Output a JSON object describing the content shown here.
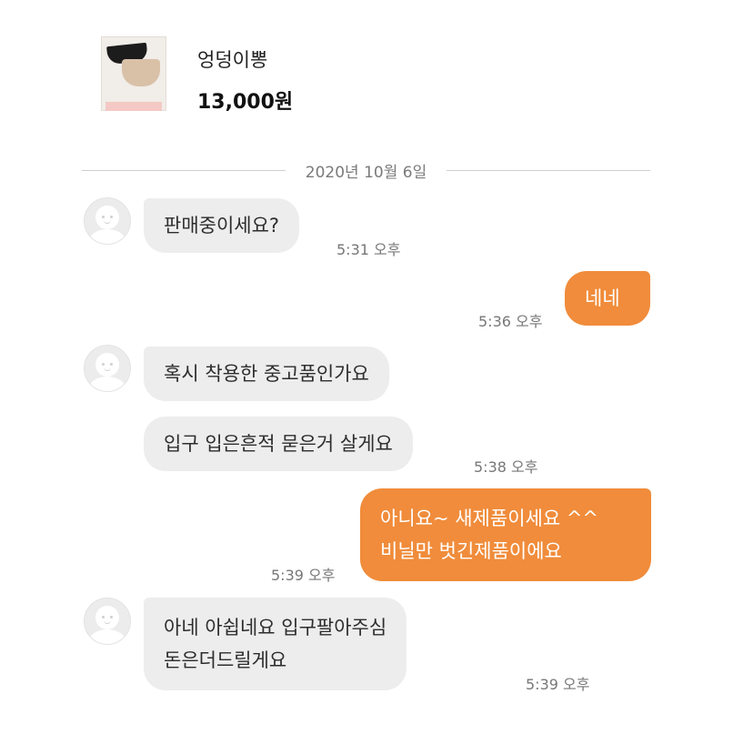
{
  "product": {
    "name": "엉덩이뽕",
    "price": "13,000원"
  },
  "date_separator": "2020년 10월 6일",
  "colors": {
    "outgoing_bubble": "#f08c3b",
    "incoming_bubble": "#ededed",
    "background": "#ffffff"
  },
  "messages": [
    {
      "sender": "other",
      "lines": [
        "판매중이세요?"
      ],
      "time": "5:31 오후"
    },
    {
      "sender": "me",
      "lines": [
        "네네"
      ],
      "time": "5:36 오후"
    },
    {
      "sender": "other",
      "lines": [
        "혹시 착용한 중고품인가요"
      ],
      "time": ""
    },
    {
      "sender": "other",
      "lines": [
        "입구 입은흔적 묻은거 살게요"
      ],
      "time": "5:38 오후"
    },
    {
      "sender": "me",
      "lines": [
        "아니요~ 새제품이세요 ^^",
        "비닐만 벗긴제품이에요"
      ],
      "time": "5:39 오후"
    },
    {
      "sender": "other",
      "lines": [
        "아네 아쉽네요 입구팔아주심",
        "돈은더드릴게요"
      ],
      "time": "5:39 오후"
    }
  ]
}
